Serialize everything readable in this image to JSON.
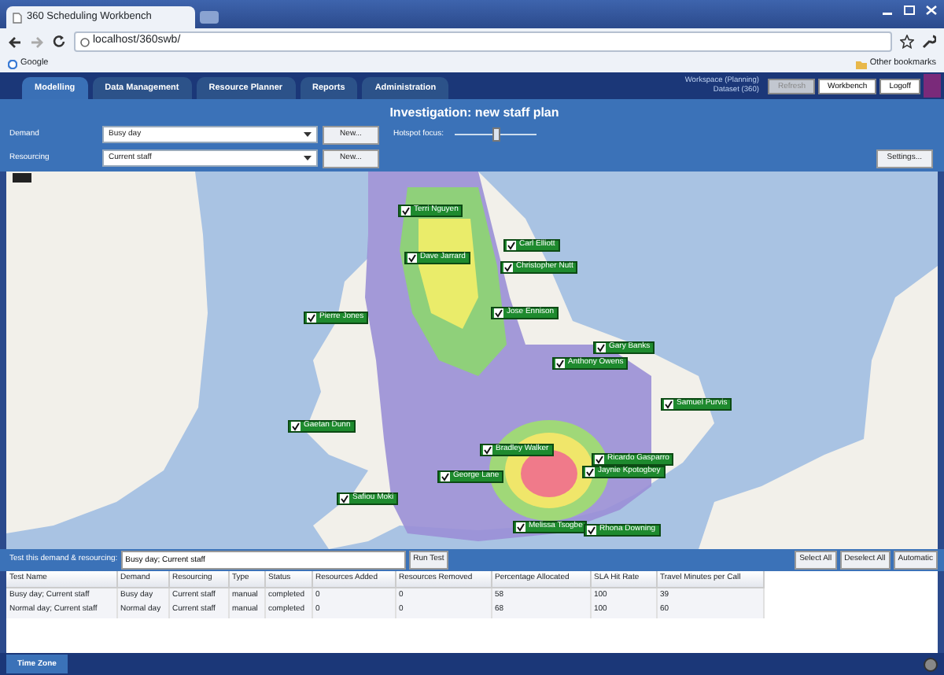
{
  "browser": {
    "tab_title": "360 Scheduling Workbench",
    "address": "localhost/360swb/",
    "bookmark": "Google",
    "other_bookmarks": "Other bookmarks"
  },
  "app_tabs": [
    {
      "label": "Modelling",
      "selected": true
    },
    {
      "label": "Data Management",
      "selected": false
    },
    {
      "label": "Resource Planner",
      "selected": false
    },
    {
      "label": "Reports",
      "selected": false
    },
    {
      "label": "Administration",
      "selected": false
    }
  ],
  "workspace": [
    "Workspace (Planning)",
    "Dataset (360)"
  ],
  "header_buttons": [
    {
      "label": "Refresh",
      "disabled": true
    },
    {
      "label": "Workbench",
      "disabled": false
    },
    {
      "label": "Logoff",
      "disabled": false
    }
  ],
  "title": "Investigation: new staff plan",
  "selectors": [
    {
      "label": "Demand",
      "value": "Busy day",
      "button": "New..."
    },
    {
      "label": "Resourcing",
      "value": "Current staff",
      "button": "New..."
    }
  ],
  "hotspot": {
    "label": "Hotspot focus:",
    "level": 0.5
  },
  "settings_button": "Settings...",
  "map": {
    "staff": [
      {
        "name": "Terri Nguyen",
        "checked": true
      },
      {
        "name": "Dave Jarrard",
        "checked": true
      },
      {
        "name": "Pierre Jones",
        "checked": true
      },
      {
        "name": "Gaetan Dunn",
        "checked": true
      },
      {
        "name": "Carl Elliott",
        "checked": true
      },
      {
        "name": "Christopher Nutt",
        "checked": true
      },
      {
        "name": "Jose Ennison",
        "checked": true
      },
      {
        "name": "Gary Banks",
        "checked": true
      },
      {
        "name": "Anthony Owens",
        "checked": true
      },
      {
        "name": "Samuel Purvis",
        "checked": true
      },
      {
        "name": "Bradley Walker",
        "checked": true
      },
      {
        "name": "Ricardo Gasparro",
        "checked": true
      },
      {
        "name": "Jaynie Kpotogbey",
        "checked": true
      },
      {
        "name": "George Lane",
        "checked": true
      },
      {
        "name": "Safiou Moki",
        "checked": true
      },
      {
        "name": "Melissa Tsogbe",
        "checked": true
      },
      {
        "name": "Rhona Downing",
        "checked": true
      }
    ]
  },
  "test_bar": {
    "label": "Test this demand & resourcing:",
    "value": "Busy day; Current staff",
    "run_button": "Run Test",
    "buttons": [
      "Select All",
      "Deselect All",
      "Automatic"
    ]
  },
  "table": {
    "columns": [
      "Test Name",
      "Demand",
      "Resourcing",
      "Type",
      "Status",
      "Resources Added",
      "Resources Removed",
      "Percentage Allocated",
      "SLA Hit Rate",
      "Travel Minutes per Call"
    ],
    "rows": [
      [
        "Busy day; Current staff",
        "Busy day",
        "Current staff",
        "manual",
        "completed",
        "0",
        "0",
        "58",
        "100",
        "39"
      ],
      [
        "Normal day; Current staff",
        "Normal day",
        "Current staff",
        "manual",
        "completed",
        "0",
        "0",
        "68",
        "100",
        "60"
      ]
    ]
  },
  "status_bar": {
    "tab": "Time Zone"
  }
}
